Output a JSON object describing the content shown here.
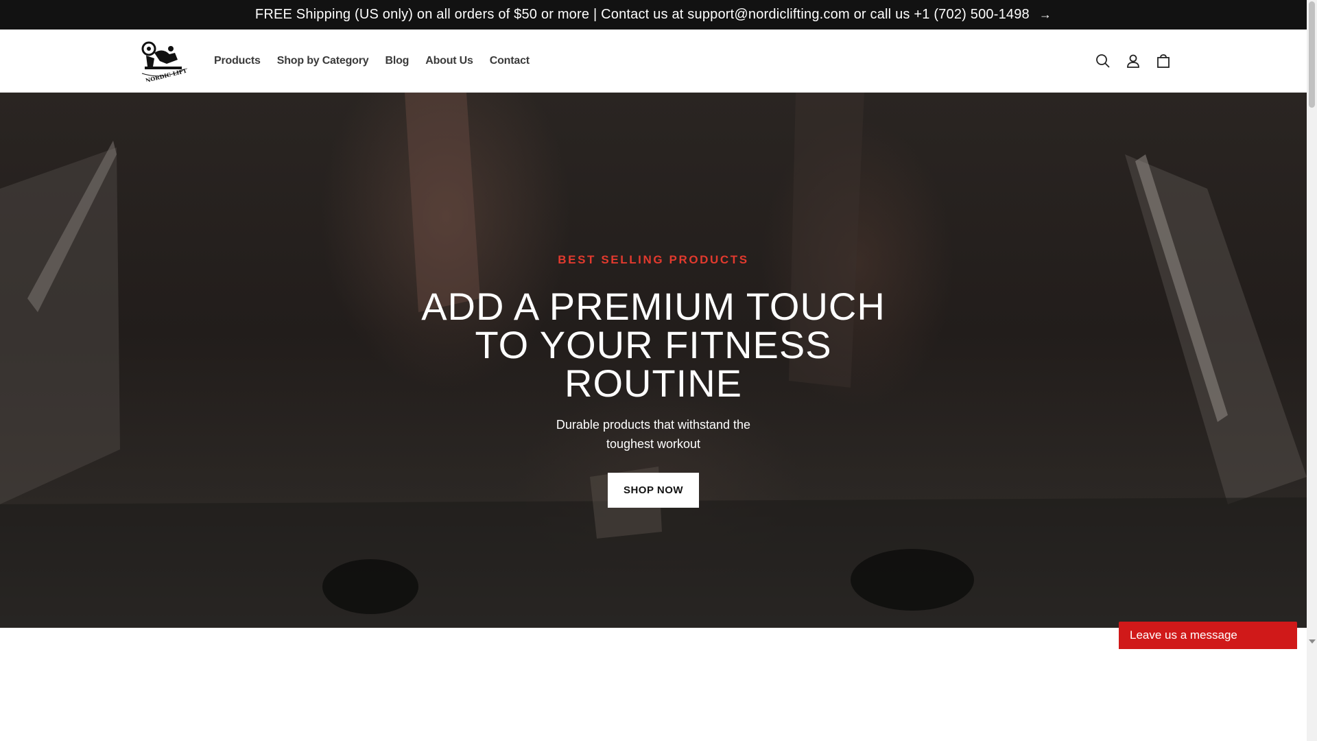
{
  "announcement": {
    "text": "FREE Shipping (US only) on all orders of $50 or more | Contact us at support@nordiclifting.com or call us +1 (702) 500-1498",
    "arrow": "→"
  },
  "header": {
    "logo_text": "NORDIC LIFTING",
    "nav": [
      {
        "label": "Products"
      },
      {
        "label": "Shop by Category"
      },
      {
        "label": "Blog"
      },
      {
        "label": "About Us"
      },
      {
        "label": "Contact"
      }
    ],
    "icons": [
      "search-icon",
      "account-icon",
      "cart-icon"
    ]
  },
  "hero": {
    "kicker": "BEST SELLING PRODUCTS",
    "headline": "ADD A PREMIUM TOUCH TO YOUR FITNESS ROUTINE",
    "subtext": "Durable products that withstand the toughest workout",
    "button_label": "SHOP NOW"
  },
  "chat": {
    "label": "Leave us a message"
  },
  "colors": {
    "announcement_bg": "#121212",
    "kicker": "#e23a2e",
    "chat_bg": "#d01919"
  }
}
